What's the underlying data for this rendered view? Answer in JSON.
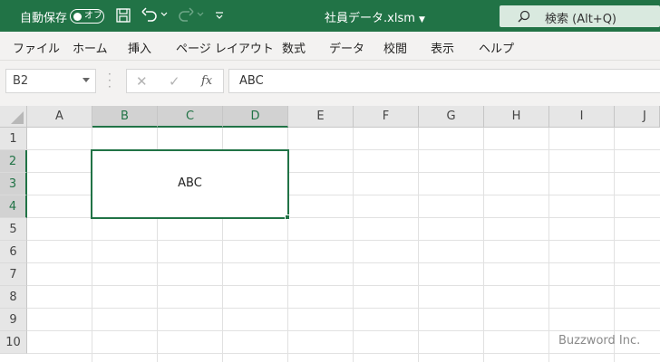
{
  "titlebar": {
    "autosave_label": "自動保存",
    "autosave_state": "オフ",
    "filename": "社員データ.xlsm",
    "search_label": "検索 (Alt+Q)",
    "accent_color": "#217346"
  },
  "menu": {
    "items": [
      "ファイル",
      "ホーム",
      "挿入",
      "ページ レイアウト",
      "数式",
      "データ",
      "校閲",
      "表示",
      "ヘルプ"
    ]
  },
  "formula_bar": {
    "name_box": "B2",
    "formula_value": "ABC",
    "fx_label": "fx"
  },
  "sheet": {
    "columns": [
      "A",
      "B",
      "C",
      "D",
      "E",
      "F",
      "G",
      "H",
      "I",
      "J"
    ],
    "rows": [
      "1",
      "2",
      "3",
      "4",
      "5",
      "6",
      "7",
      "8",
      "9",
      "10"
    ],
    "merged_cell_value": "ABC"
  },
  "watermark": "Buzzword Inc."
}
